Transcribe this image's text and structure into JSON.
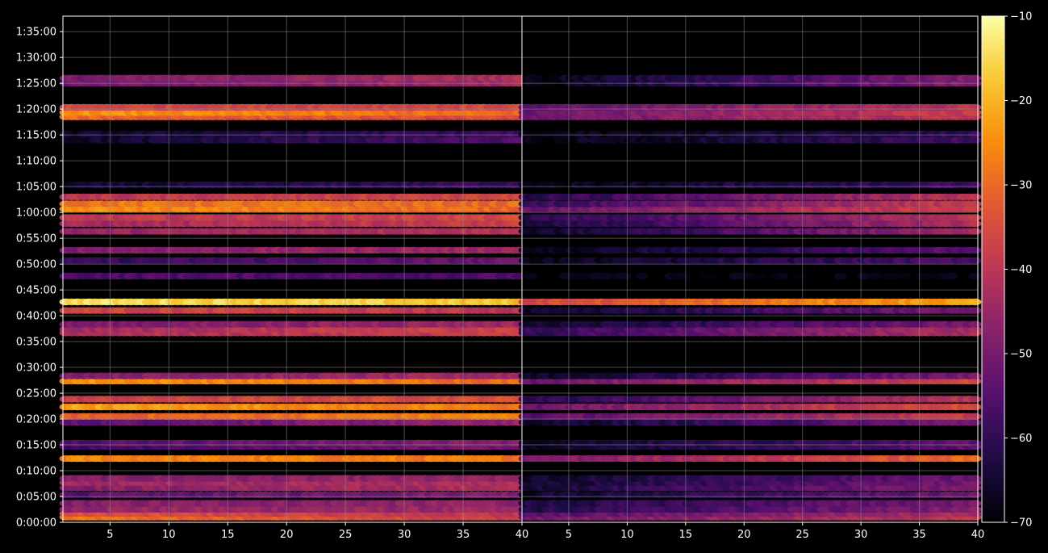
{
  "chart_data": {
    "type": "heatmap",
    "title": "",
    "xlabel": "",
    "ylabel": "",
    "grid": true,
    "panels": [
      {
        "name": "",
        "xlim": [
          1,
          40
        ],
        "xticks": [
          5,
          10,
          15,
          20,
          25,
          30,
          35,
          40
        ],
        "activity_start_x": 1
      },
      {
        "name": "",
        "xlim": [
          1,
          40
        ],
        "xticks": [
          5,
          10,
          15,
          20,
          25,
          30,
          35,
          40
        ],
        "activity_start_x": 1
      }
    ],
    "ylim_seconds": [
      0,
      5880
    ],
    "yticks": [
      {
        "value": 0,
        "label": "0:00:00"
      },
      {
        "value": 300,
        "label": "0:05:00"
      },
      {
        "value": 600,
        "label": "0:10:00"
      },
      {
        "value": 900,
        "label": "0:15:00"
      },
      {
        "value": 1200,
        "label": "0:20:00"
      },
      {
        "value": 1500,
        "label": "0:25:00"
      },
      {
        "value": 1800,
        "label": "0:30:00"
      },
      {
        "value": 2100,
        "label": "0:35:00"
      },
      {
        "value": 2400,
        "label": "0:40:00"
      },
      {
        "value": 2700,
        "label": "0:45:00"
      },
      {
        "value": 3000,
        "label": "0:50:00"
      },
      {
        "value": 3300,
        "label": "0:55:00"
      },
      {
        "value": 3600,
        "label": "1:00:00"
      },
      {
        "value": 3900,
        "label": "1:05:00"
      },
      {
        "value": 4200,
        "label": "1:10:00"
      },
      {
        "value": 4500,
        "label": "1:15:00"
      },
      {
        "value": 4800,
        "label": "1:20:00"
      },
      {
        "value": 5100,
        "label": "1:25:00"
      },
      {
        "value": 5400,
        "label": "1:30:00"
      },
      {
        "value": 5700,
        "label": "1:35:00"
      }
    ],
    "bands": [
      {
        "y": 60,
        "left": [
          -28,
          -38
        ],
        "right": [
          -50,
          -40
        ]
      },
      {
        "y": 100,
        "left": [
          -34,
          -40
        ],
        "right": [
          -55,
          -42
        ]
      },
      {
        "y": 150,
        "left": [
          -45,
          -45
        ],
        "right": [
          -62,
          -48
        ]
      },
      {
        "y": 220,
        "left": [
          -48,
          -46
        ],
        "right": [
          -63,
          -50
        ]
      },
      {
        "y": 320,
        "left": [
          -55,
          -48
        ],
        "right": [
          -66,
          -52
        ]
      },
      {
        "y": 400,
        "left": [
          -48,
          -42
        ],
        "right": [
          -64,
          -48
        ]
      },
      {
        "y": 460,
        "left": [
          -44,
          -42
        ],
        "right": [
          -66,
          -50
        ]
      },
      {
        "y": 510,
        "left": [
          -48,
          -46
        ],
        "right": [
          -66,
          -52
        ]
      },
      {
        "y": 740,
        "left": [
          -26,
          -28
        ],
        "right": [
          -50,
          -30
        ]
      },
      {
        "y": 880,
        "left": [
          -58,
          -50
        ],
        "right": [
          -66,
          -54
        ]
      },
      {
        "y": 920,
        "left": [
          -55,
          -48
        ],
        "right": [
          -66,
          -54
        ]
      },
      {
        "y": 1160,
        "left": [
          -54,
          -46
        ],
        "right": [
          -66,
          -50
        ]
      },
      {
        "y": 1230,
        "left": [
          -32,
          -26
        ],
        "right": [
          -55,
          -38
        ]
      },
      {
        "y": 1340,
        "left": [
          -22,
          -28
        ],
        "right": [
          -52,
          -34
        ]
      },
      {
        "y": 1430,
        "left": [
          -38,
          -34
        ],
        "right": [
          -62,
          -40
        ]
      },
      {
        "y": 1640,
        "left": [
          -24,
          -30
        ],
        "right": [
          -52,
          -36
        ]
      },
      {
        "y": 1700,
        "left": [
          -48,
          -44
        ],
        "right": [
          -66,
          -50
        ]
      },
      {
        "y": 2200,
        "left": [
          -42,
          -38
        ],
        "right": [
          -60,
          -42
        ]
      },
      {
        "y": 2240,
        "left": [
          -44,
          -36
        ],
        "right": [
          -60,
          -42
        ]
      },
      {
        "y": 2300,
        "left": [
          -50,
          -44
        ],
        "right": [
          -66,
          -50
        ]
      },
      {
        "y": 2460,
        "left": [
          -36,
          -40
        ],
        "right": [
          -66,
          -50
        ]
      },
      {
        "y": 2560,
        "left": [
          -14,
          -18
        ],
        "right": [
          -36,
          -22
        ]
      },
      {
        "y": 2860,
        "left": [
          -56,
          -56
        ],
        "right": [
          -69,
          -69
        ]
      },
      {
        "y": 3040,
        "left": [
          -60,
          -52
        ],
        "right": [
          -68,
          -56
        ]
      },
      {
        "y": 3160,
        "left": [
          -48,
          -44
        ],
        "right": [
          -68,
          -54
        ]
      },
      {
        "y": 3380,
        "left": [
          -46,
          -40
        ],
        "right": [
          -66,
          -44
        ]
      },
      {
        "y": 3470,
        "left": [
          -44,
          -38
        ],
        "right": [
          -64,
          -42
        ]
      },
      {
        "y": 3540,
        "left": [
          -40,
          -36
        ],
        "right": [
          -62,
          -40
        ]
      },
      {
        "y": 3640,
        "left": [
          -24,
          -30
        ],
        "right": [
          -52,
          -36
        ]
      },
      {
        "y": 3700,
        "left": [
          -28,
          -30
        ],
        "right": [
          -60,
          -38
        ]
      },
      {
        "y": 3780,
        "left": [
          -40,
          -36
        ],
        "right": [
          -62,
          -40
        ]
      },
      {
        "y": 3920,
        "left": [
          -66,
          -58
        ],
        "right": [
          -68,
          -58
        ]
      },
      {
        "y": 4440,
        "left": [
          -66,
          -56
        ],
        "right": [
          -69,
          -58
        ]
      },
      {
        "y": 4510,
        "left": [
          -66,
          -58
        ],
        "right": [
          -69,
          -60
        ]
      },
      {
        "y": 4710,
        "left": [
          -30,
          -36
        ],
        "right": [
          -52,
          -40
        ]
      },
      {
        "y": 4760,
        "left": [
          -24,
          -30
        ],
        "right": [
          -52,
          -38
        ]
      },
      {
        "y": 4820,
        "left": [
          -36,
          -36
        ],
        "right": [
          -54,
          -40
        ]
      },
      {
        "y": 5100,
        "left": [
          -52,
          -44
        ],
        "right": [
          -69,
          -48
        ]
      },
      {
        "y": 5160,
        "left": [
          -50,
          -42
        ],
        "right": [
          -69,
          -48
        ]
      }
    ],
    "colorbar": {
      "colormap": "inferno",
      "range": [
        -70,
        -10
      ],
      "ticks": [
        -70,
        -60,
        -50,
        -40,
        -30,
        -20,
        -10
      ],
      "labels": [
        "−70",
        "−60",
        "−50",
        "−40",
        "−30",
        "−20",
        "−10"
      ]
    },
    "colors": {
      "background": "#000000",
      "grid": "#8c8c8c",
      "axis": "#ffffff",
      "text": "#ffffff"
    }
  }
}
